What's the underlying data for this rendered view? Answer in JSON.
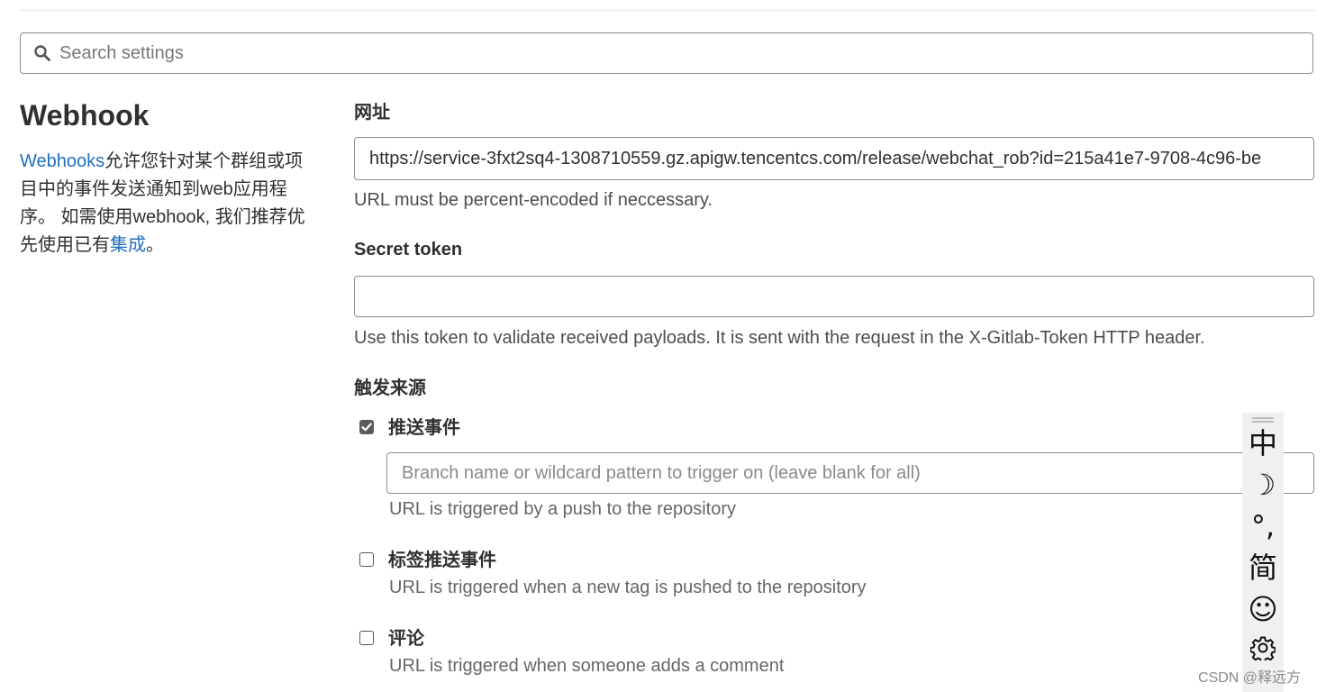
{
  "search": {
    "placeholder": "Search settings",
    "icon": "search-icon"
  },
  "sidebar": {
    "title": "Webhook",
    "desc_link1": "Webhooks",
    "desc_text": "允许您针对某个群组或项目中的事件发送通知到web应用程序。 如需使用webhook, 我们推荐优先使用已有",
    "desc_link2": "集成",
    "desc_end": "。"
  },
  "url": {
    "label": "网址",
    "value": "https://service-3fxt2sq4-1308710559.gz.apigw.tencentcs.com/release/webchat_rob?id=215a41e7-9708-4c96-be",
    "help": "URL must be percent-encoded if neccessary."
  },
  "secret": {
    "label": "Secret token",
    "value": "",
    "help": "Use this token to validate received payloads. It is sent with the request in the X-Gitlab-Token HTTP header."
  },
  "triggers": {
    "label": "触发来源",
    "push": {
      "label": "推送事件",
      "checked": true,
      "branch_placeholder": "Branch name or wildcard pattern to trigger on (leave blank for all)",
      "help": "URL is triggered by a push to the repository"
    },
    "tag_push": {
      "label": "标签推送事件",
      "checked": false,
      "help": "URL is triggered when a new tag is pushed to the repository"
    },
    "comment": {
      "label": "评论",
      "checked": false,
      "help": "URL is triggered when someone adds a comment"
    }
  },
  "ime": {
    "mode": "中",
    "moon": "☽",
    "punct": "°,",
    "script": "简",
    "emoji": "☺",
    "settings_icon": "gear-icon"
  },
  "watermark": "CSDN @释远方",
  "colors": {
    "link": "#1f6fbf",
    "text": "#303030",
    "border": "#8c8c8c",
    "ime_bg": "#f0f0f0"
  }
}
